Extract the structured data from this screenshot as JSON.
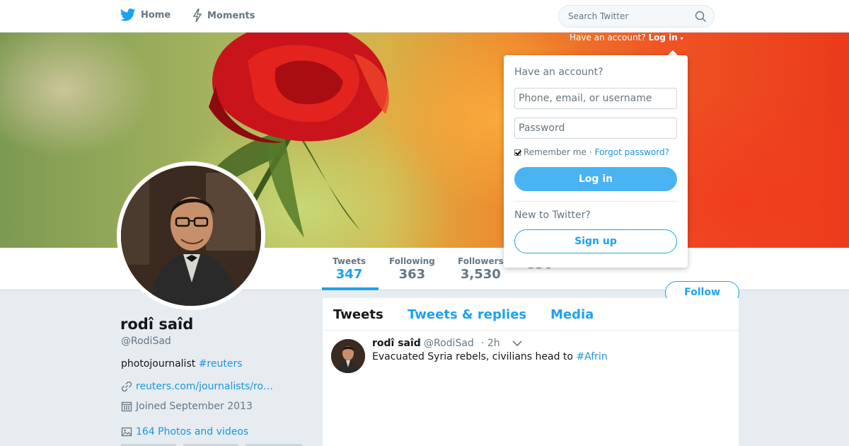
{
  "nav": {
    "home_label": "Home",
    "moments_label": "Moments",
    "search_placeholder": "Search Twitter"
  },
  "login_hint": {
    "prefix": "Have an account?",
    "link": "Log in"
  },
  "stats": [
    {
      "label": "Tweets",
      "value": "347"
    },
    {
      "label": "Following",
      "value": "363"
    },
    {
      "label": "Followers",
      "value": "3,530"
    },
    {
      "label": "",
      "value": "830"
    }
  ],
  "follow_label": "Follow",
  "profile": {
    "name": "rodî saîd",
    "handle": "@RodiSad",
    "bio_text": "photojournalist ",
    "bio_tag": "#reuters",
    "url": "reuters.com/journalists/ro…",
    "joined": "Joined September 2013",
    "photos": "164 Photos and videos"
  },
  "timeline": {
    "tabs": [
      "Tweets",
      "Tweets & replies",
      "Media"
    ]
  },
  "tweet": {
    "name": "rodî saîd",
    "handle": "@RodiSad",
    "time": "· 2h",
    "text": "Evacuated Syria rebels, civilians head to ",
    "tag": "#Afrin"
  },
  "login_dropdown": {
    "title": "Have an account?",
    "username_placeholder": "Phone, email, or username",
    "password_placeholder": "Password",
    "remember_label": "Remember me",
    "separator": "·",
    "forgot_label": "Forgot password?",
    "login_label": "Log in",
    "new_label": "New to Twitter?",
    "signup_label": "Sign up"
  },
  "colors": {
    "accent": "#1da1f2",
    "link": "#1b95e0",
    "login_button": "#4ab3f4"
  }
}
